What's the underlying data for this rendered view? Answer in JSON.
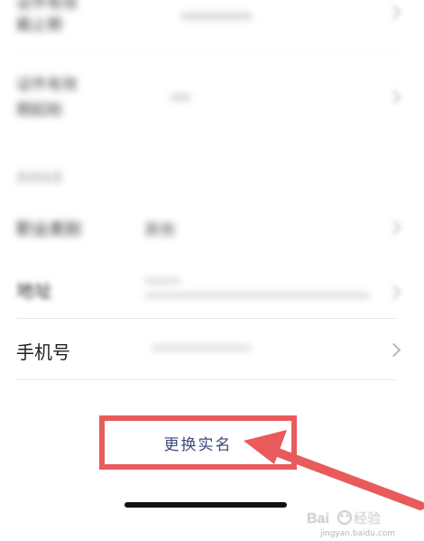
{
  "rows": {
    "r0": {
      "label_line1": "证件有效",
      "label_line2": "截止期",
      "value": "——————"
    },
    "r1": {
      "label_line1": "证件有效",
      "label_line2": "期起始",
      "value": "———"
    },
    "section_heading": "其他信息",
    "occupation": {
      "label": "职业类别",
      "value": "其他"
    },
    "address": {
      "label": "地址",
      "value": "———"
    },
    "phone": {
      "label": "手机号",
      "value": "———"
    }
  },
  "actions": {
    "change_real_name": "更换实名"
  },
  "watermark": {
    "url": "jingyan.baidu.com"
  },
  "colors": {
    "highlight_red": "#e95b5b",
    "button_text": "#3b4a7a",
    "divider": "#e8e8e8",
    "chevron": "#b8b8b8"
  }
}
